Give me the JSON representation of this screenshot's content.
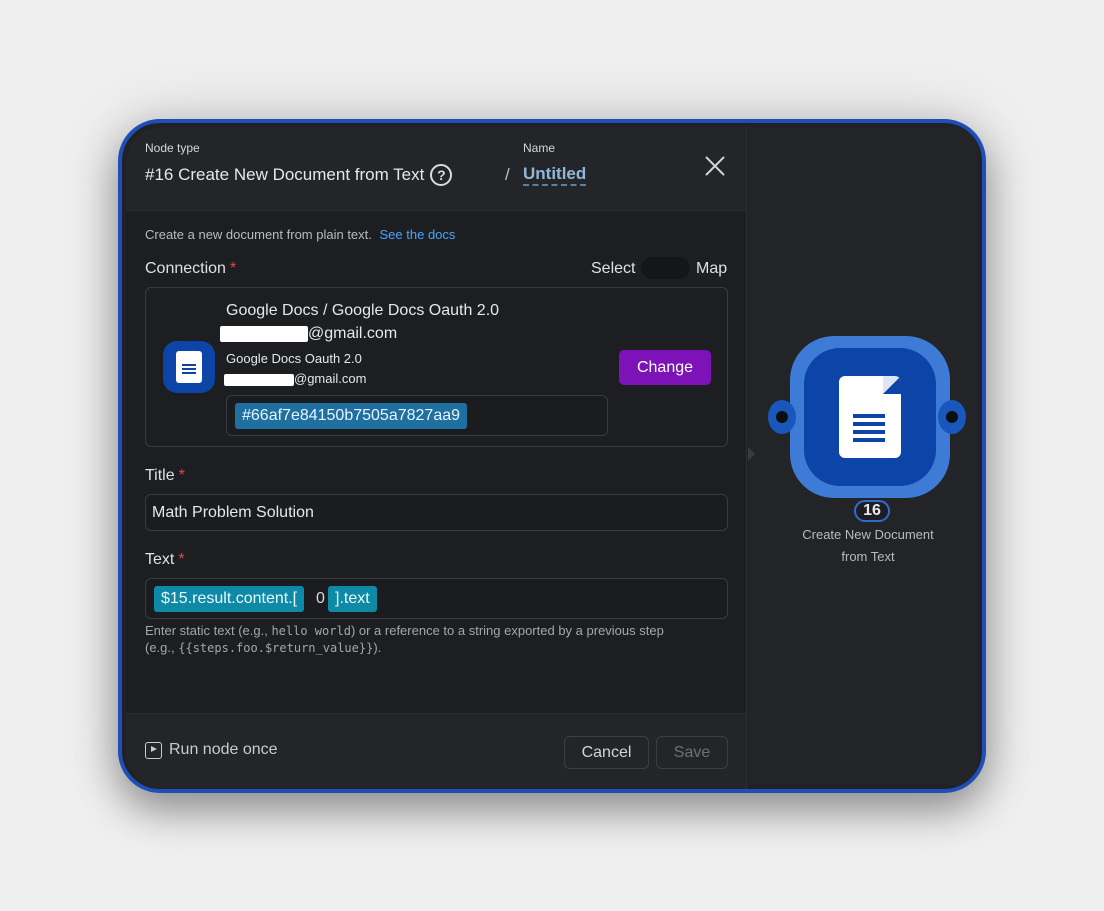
{
  "header": {
    "node_type_label": "Node type",
    "node_type_value": "#16 Create New Document from Text",
    "separator": "/",
    "name_label": "Name",
    "name_value": "Untitled"
  },
  "description": {
    "text": "Create a new document from plain text.",
    "link": "See the docs"
  },
  "connection": {
    "label": "Connection",
    "required_mark": "*",
    "toggle_select": "Select",
    "toggle_map": "Map",
    "app_title": "Google Docs / Google Docs Oauth 2.0",
    "account_email_suffix": "@gmail.com",
    "account_type": "Google Docs Oauth 2.0",
    "account_email_suffix_2": "@gmail.com",
    "change_label": "Change",
    "connection_id": "#66af7e84150b7505a7827aa9",
    "icon": "google-docs-icon"
  },
  "title_field": {
    "label": "Title",
    "required_mark": "*",
    "value": "Math Problem Solution"
  },
  "text_field": {
    "label": "Text",
    "required_mark": "*",
    "chip_1": "$15.result.content.[",
    "index": "0",
    "chip_2": "].text",
    "hint_part1": "Enter static text (e.g.,",
    "hint_code1": "hello world",
    "hint_part2": ") or a reference to a string exported by a previous step",
    "hint_part3": "(e.g.,",
    "hint_code2": "{{steps.foo.$return_value}}",
    "hint_part4": ")."
  },
  "footer": {
    "run_once_label": "Run node once",
    "cancel_label": "Cancel",
    "save_label": "Save"
  },
  "node": {
    "number": "16",
    "label_line1": "Create New Document",
    "label_line2": "from Text"
  },
  "colors": {
    "accent_purple": "#7d12b8",
    "link_blue": "#4aa3ff",
    "node_blue": "#0c44a8",
    "frame_blue": "#1e4fb8",
    "chip_teal": "#0e8aa6",
    "chip_blue": "#1f6fa0"
  }
}
